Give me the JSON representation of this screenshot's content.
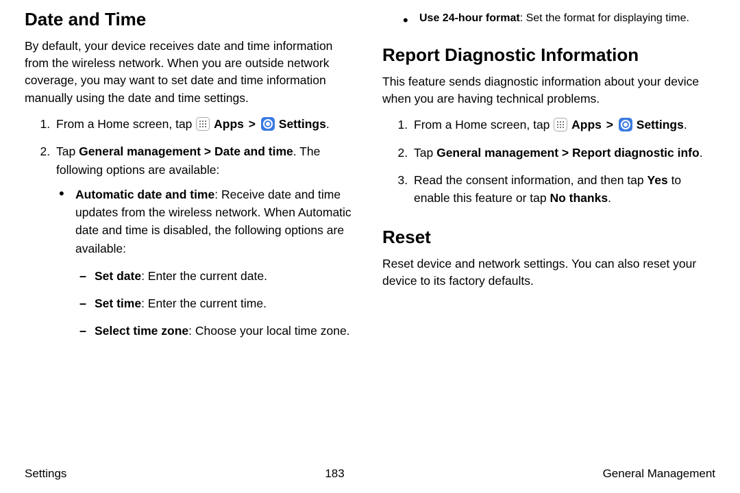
{
  "left": {
    "heading": "Date and Time",
    "intro": "By default, your device receives date and time information from the wireless network. When you are outside network coverage, you may want to set date and time information manually using the date and time settings.",
    "step1_a": "From a Home screen, tap ",
    "apps": "Apps",
    "settings": "Settings",
    "step2_a": "Tap ",
    "step2_b": "General management > Date and time",
    "step2_c": ". The following options are available:",
    "opt1_b": "Automatic date and time",
    "opt1_c": ": Receive date and time updates from the wireless network. When Automatic date and time is disabled, the following options are available:",
    "sub1_b": "Set date",
    "sub1_c": ": Enter the current date.",
    "sub2_b": "Set time",
    "sub2_c": ": Enter the current time.",
    "sub3_b": "Select time zone",
    "sub3_c": ": Choose your local time zone."
  },
  "right": {
    "opt24_b": "Use 24-hour format",
    "opt24_c": ": Set the format for displaying time.",
    "heading_diag": "Report Diagnostic Information",
    "diag_intro": "This feature sends diagnostic information about your device when you are having technical problems.",
    "d1_a": "From a Home screen, tap ",
    "apps": "Apps",
    "settings": "Settings",
    "d2_a": "Tap ",
    "d2_b": "General management > Report diagnostic info",
    "d2_c": ".",
    "d3_a": "Read the consent information, and then tap ",
    "d3_b": "Yes",
    "d3_c": " to enable this feature or tap ",
    "d3_d": "No thanks",
    "d3_e": ".",
    "heading_reset": "Reset",
    "reset_intro": "Reset device and network settings. You can also reset your device to its factory defaults."
  },
  "footer": {
    "left": "Settings",
    "center": "183",
    "right": "General Management"
  }
}
